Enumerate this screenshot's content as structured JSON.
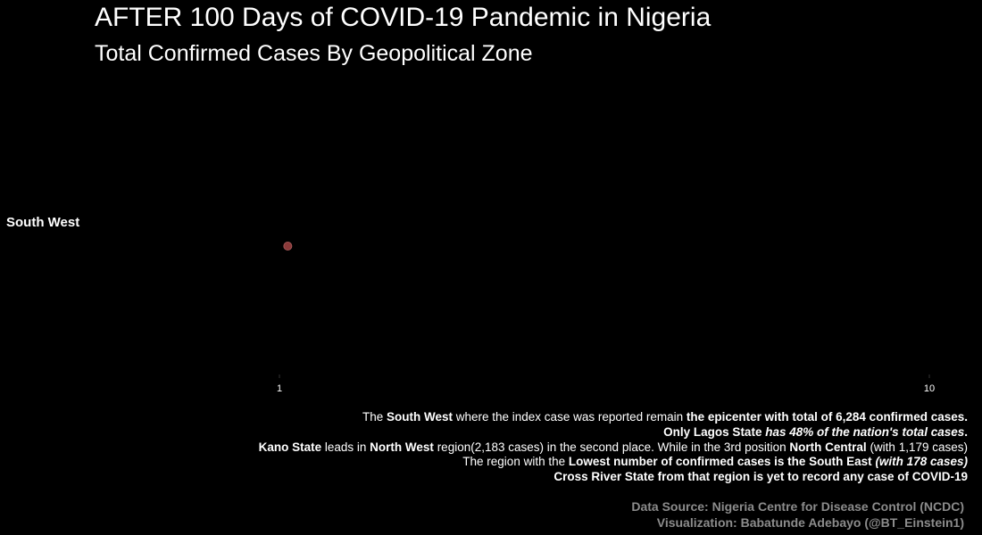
{
  "title": "AFTER 100 Days of COVID-19 Pandemic in Nigeria",
  "subtitle": "Total Confirmed Cases By Geopolitical Zone",
  "chart_data": {
    "type": "scatter",
    "title": "AFTER 100 Days of COVID-19 Pandemic in Nigeria",
    "subtitle": "Total Confirmed Cases By Geopolitical Zone",
    "categories": [
      "South West"
    ],
    "x_scale": "log",
    "xlim": [
      1,
      10
    ],
    "x_ticks": [
      "1",
      "10"
    ],
    "series": [
      {
        "category": "South West",
        "x": 1.03,
        "color": "#8b3a3a"
      }
    ],
    "grid": false,
    "background": "#000000"
  },
  "notes": {
    "l1": {
      "a": "The ",
      "b": "South West",
      "c": " where the index case was reported remain ",
      "d": "the epicenter with total of 6,284 confirmed cases."
    },
    "l2": {
      "a": "Only Lagos State ",
      "b": "has 48% of the nation's total cases",
      "c": "."
    },
    "l3": {
      "a": "Kano State",
      "b": " leads in ",
      "c": "North West",
      "d": " region(2,183 cases) in the second place. While in the 3rd position ",
      "e": "North Central",
      "f": " (with 1,179 cases)"
    },
    "l4": {
      "a": "The region with the ",
      "b": "Lowest number of confirmed cases is the South East",
      "c": " (with 178 cases)"
    },
    "l5": {
      "a": "Cross River State",
      "b": " from that region is yet to record any case of COVID-19"
    }
  },
  "source": {
    "data": "Data Source: Nigeria Centre for Disease Control (NCDC)",
    "viz": "Visualization: Babatunde Adebayo (@BT_Einstein1)"
  }
}
